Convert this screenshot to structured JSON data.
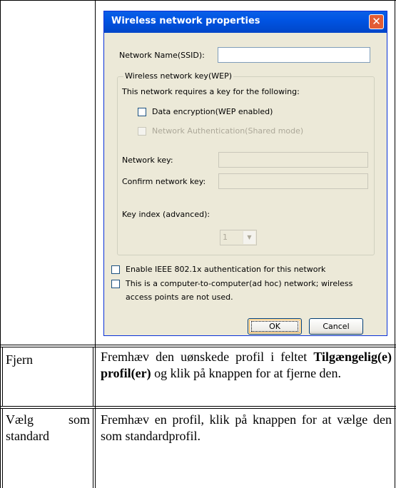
{
  "dialog": {
    "title": "Wireless network properties",
    "close_glyph": "✕",
    "ssid_label": "Network Name(SSID):",
    "ssid_value": "",
    "wep_group_label": "Wireless network key(WEP)",
    "requires_key_text": "This network requires a key for the following:",
    "data_encryption_label": "Data encryption(WEP enabled)",
    "data_encryption_checked": false,
    "network_auth_label": "Network Authentication(Shared mode)",
    "network_auth_checked": false,
    "network_key_label": "Network key:",
    "network_key_value": "",
    "confirm_key_label": "Confirm network key:",
    "confirm_key_value": "",
    "key_index_label": "Key index (advanced):",
    "key_index_value": "1",
    "ieee_label": "Enable IEEE 802.1x authentication for this network",
    "ieee_checked": false,
    "adhoc_label_line1": "This is a computer-to-computer(ad hoc) network; wireless",
    "adhoc_label_line2": "access points are not used.",
    "adhoc_checked": false,
    "ok_label": "OK",
    "cancel_label": "Cancel",
    "titlebar_color": "#0054E3"
  },
  "rows": [
    {
      "name": "Fjern",
      "desc_pre": "Fremhæv den uønskede profil i feltet ",
      "desc_bold": "Tilgængelig(e) profil(er)",
      "desc_post": " og klik på knappen for at fjerne den."
    },
    {
      "name": "Vælg som standard",
      "desc_pre": "Fremhæv en profil, klik på knappen for at vælge den som standardprofil.",
      "desc_bold": "",
      "desc_post": ""
    }
  ]
}
